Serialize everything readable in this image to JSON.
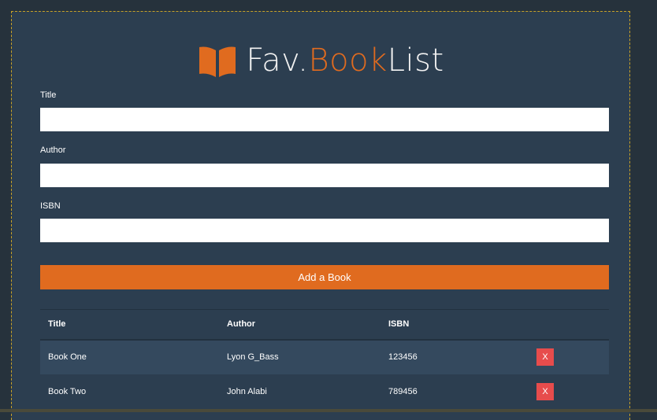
{
  "header": {
    "title_part1": "Fav.",
    "title_part2": "Book",
    "title_part3": "List",
    "icon": "open-book-icon",
    "accent_color": "#e06b1f"
  },
  "form": {
    "title_label": "Title",
    "title_value": "",
    "author_label": "Author",
    "author_value": "",
    "isbn_label": "ISBN",
    "isbn_value": "",
    "submit_label": "Add a Book"
  },
  "table": {
    "headers": [
      "Title",
      "Author",
      "ISBN"
    ],
    "rows": [
      {
        "title": "Book One",
        "author": "Lyon G_Bass",
        "isbn": "123456",
        "delete_label": "X"
      },
      {
        "title": "Book Two",
        "author": "John Alabi",
        "isbn": "789456",
        "delete_label": "X"
      }
    ]
  }
}
